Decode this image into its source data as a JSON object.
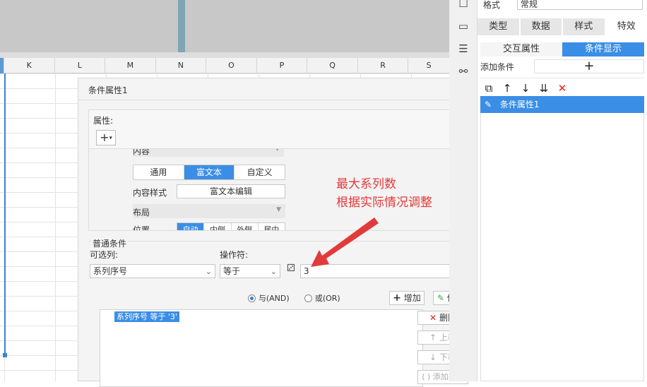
{
  "sheet": {
    "columns": [
      "K",
      "L",
      "M",
      "N",
      "O",
      "P",
      "Q",
      "R",
      "S"
    ]
  },
  "dialog": {
    "title": "条件属性1",
    "properties_label": "属性:",
    "add_icon": "plus-icon",
    "content_row_label": "内容",
    "content_types": [
      "通用",
      "富文本",
      "自定义"
    ],
    "content_type_selected": "富文本",
    "content_style_label": "内容样式",
    "content_style_button": "富文本编辑",
    "layout_label": "布局",
    "position_label": "位置",
    "position_options": [
      "自动",
      "内侧",
      "外侧",
      "居中"
    ],
    "common_condition_label": "普通条件",
    "optional_column_label": "可选列:",
    "optional_column_value": "系列序号",
    "operator_label": "操作符:",
    "operator_value": "等于",
    "value_input": "3",
    "and_label": "与(AND)",
    "or_label": "或(OR)",
    "add_button": "增加",
    "modify_button": "修改",
    "condition_item": "系列序号 等于 '3'",
    "delete_button": "删除",
    "up_button": "上移",
    "down_button": "下移",
    "bracket_button": "添加括号"
  },
  "annotation": {
    "line1": "最大系列数",
    "line2": "根据实际情况调整",
    "color": "#e23b3b"
  },
  "right_panel": {
    "format_label": "格式",
    "format_value": "常规",
    "tabs": [
      "类型",
      "数据",
      "样式",
      "特效"
    ],
    "subtabs": [
      "交互属性",
      "条件显示"
    ],
    "active_subtab": "条件显示",
    "add_condition_label": "添加条件",
    "add_condition_icon": "plus-icon",
    "toolbar_icons": [
      "copy-icon",
      "arrow-up-icon",
      "arrow-down-icon",
      "move-bottom-icon",
      "delete-x-icon"
    ],
    "condition_attr": "条件属性1"
  },
  "colors": {
    "accent": "#3b8ee5",
    "annotation_red": "#e23b3b"
  }
}
